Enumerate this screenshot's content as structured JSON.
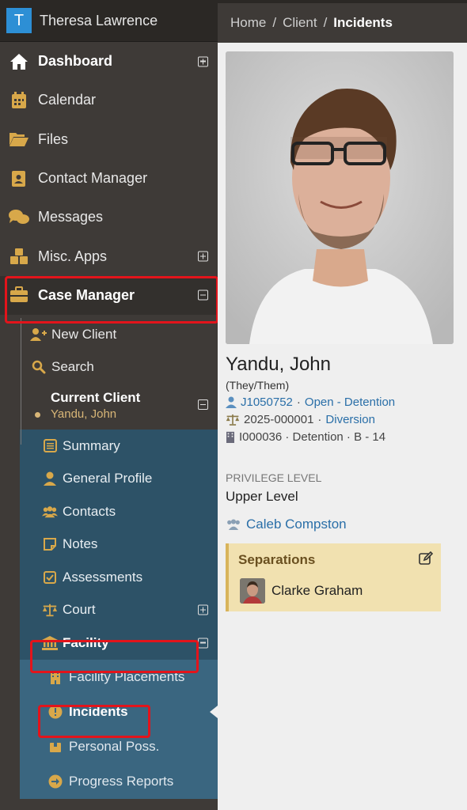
{
  "user": {
    "logo_letter": "T",
    "name": "Theresa Lawrence"
  },
  "nav": {
    "dashboard": "Dashboard",
    "calendar": "Calendar",
    "files": "Files",
    "contact_manager": "Contact Manager",
    "messages": "Messages",
    "misc_apps": "Misc. Apps",
    "case_manager": "Case Manager"
  },
  "case_manager_sub": {
    "new_client": "New Client",
    "search": "Search",
    "current_client_label": "Current Client",
    "current_client_value": "Yandu, John"
  },
  "client_menu": {
    "summary": "Summary",
    "general_profile": "General Profile",
    "contacts": "Contacts",
    "notes": "Notes",
    "assessments": "Assessments",
    "court": "Court",
    "facility": "Facility"
  },
  "facility_menu": {
    "placements": "Facility Placements",
    "incidents": "Incidents",
    "personal_poss": "Personal Poss.",
    "progress_reports": "Progress Reports"
  },
  "breadcrumb": {
    "home": "Home",
    "client": "Client",
    "current": "Incidents",
    "separator": "/"
  },
  "client": {
    "name": "Yandu, John",
    "pronouns": "(They/Them)",
    "juvenile_id": "J1050752",
    "juvenile_status": "Open - Detention",
    "case_number": "2025-000001",
    "case_type": "Diversion",
    "facility_line": "I000036 · Detention · B - 14",
    "privilege_label": "PRIVILEGE LEVEL",
    "privilege_value": "Upper Level",
    "worker": "Caleb Compston"
  },
  "separations": {
    "title": "Separations",
    "person": "Clarke Graham"
  },
  "colors": {
    "accent_blue": "#2d8fd5",
    "highlight_red": "#e3141b",
    "client_menu_bg": "#2d5267",
    "separation_bg": "#f1e1b0"
  }
}
